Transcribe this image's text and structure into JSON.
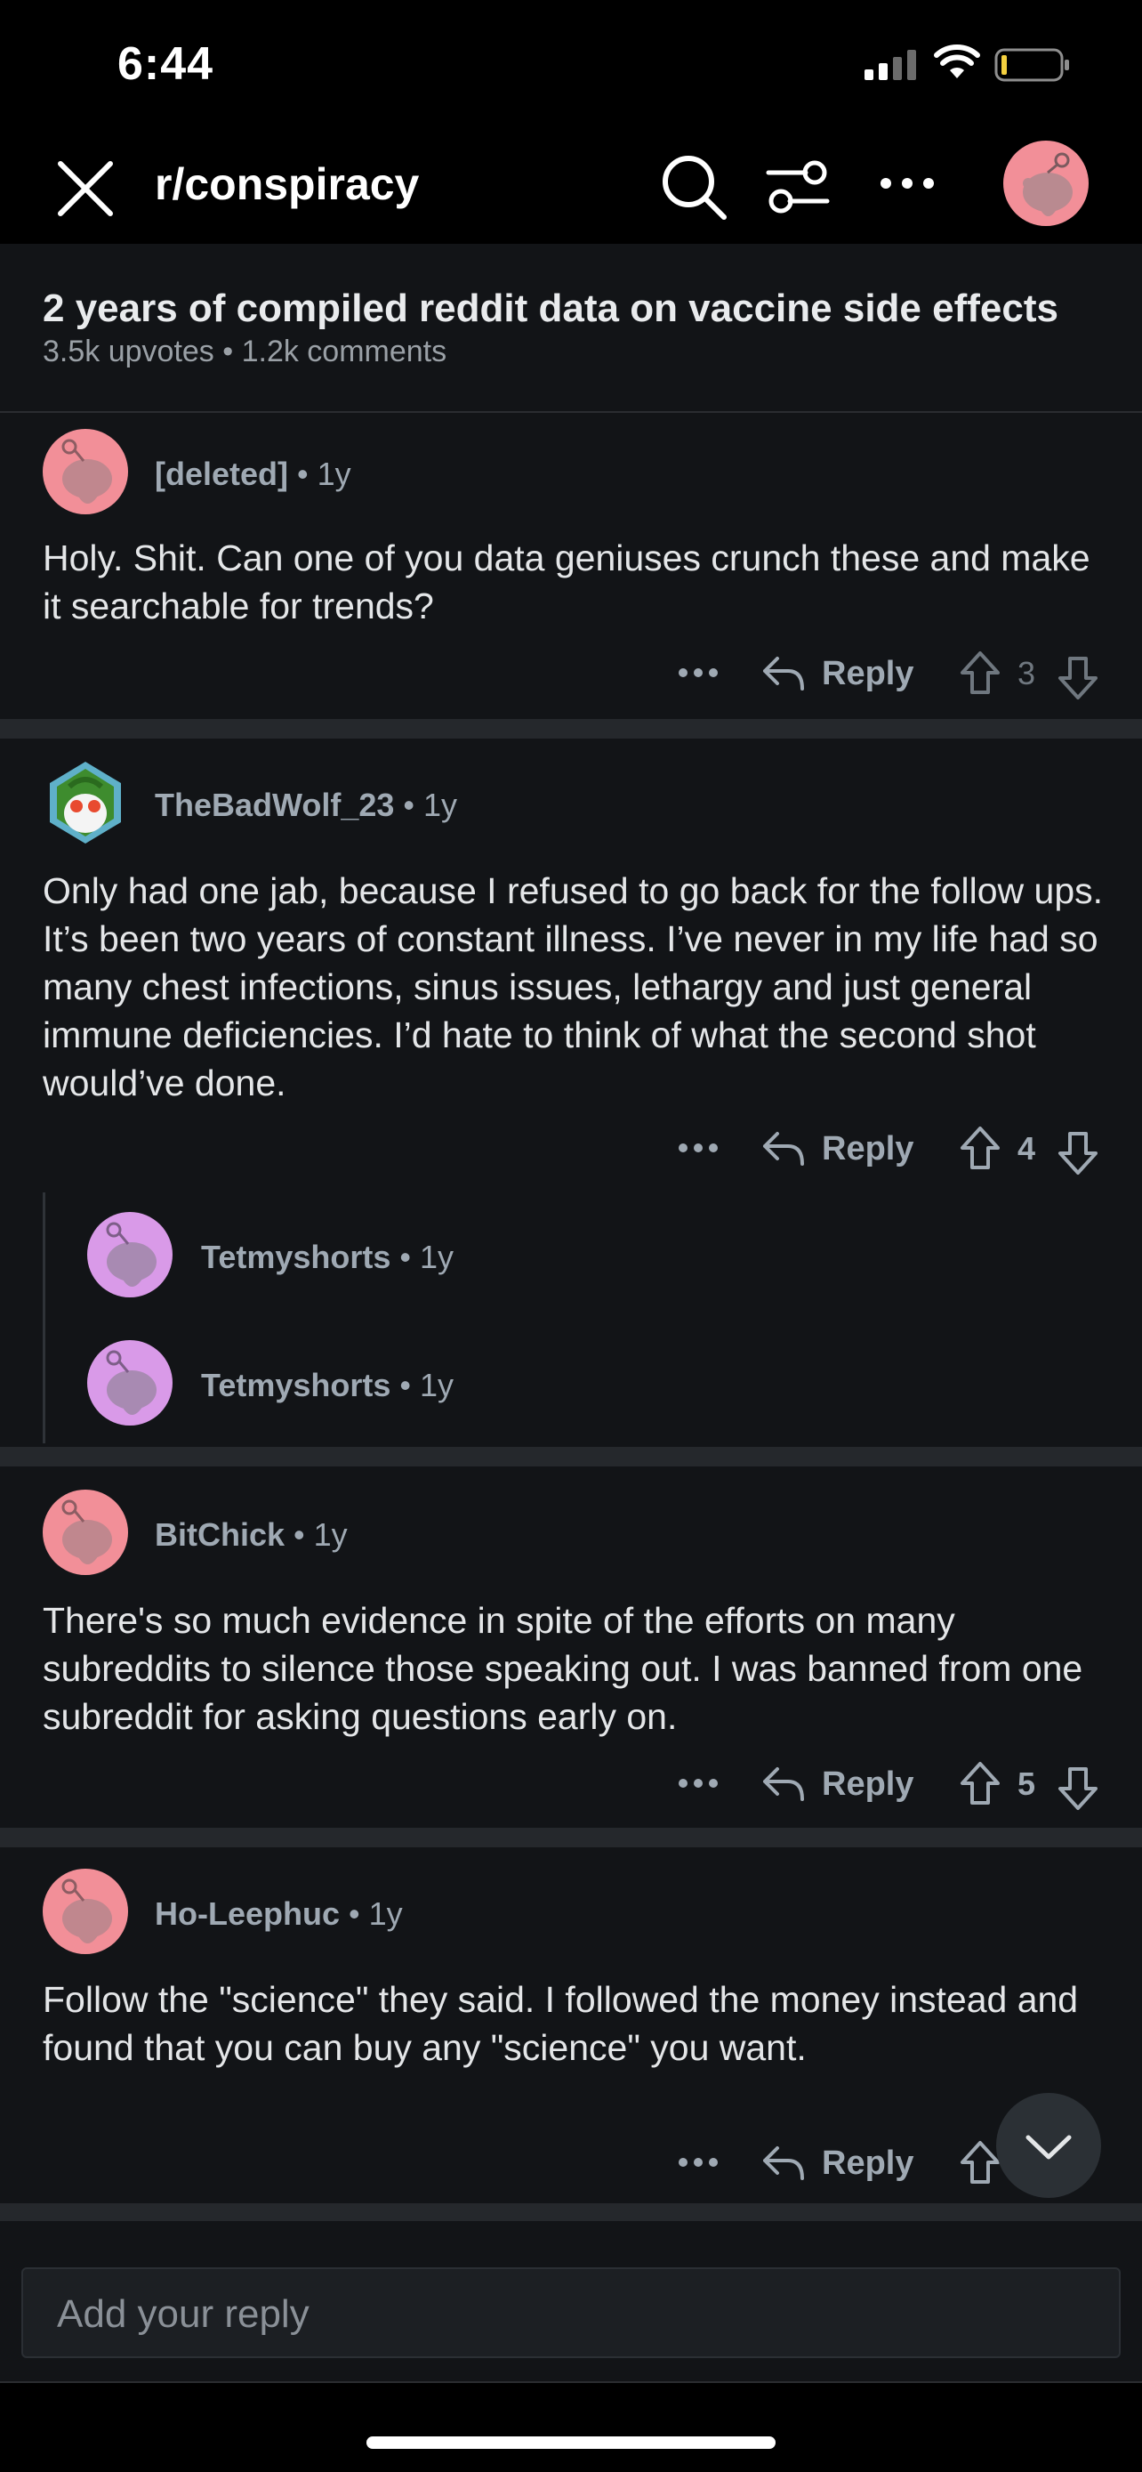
{
  "status": {
    "time": "6:44"
  },
  "nav": {
    "subreddit": "r/conspiracy"
  },
  "post": {
    "title": "2 years of compiled reddit data on vaccine side effects",
    "meta": "3.5k upvotes • 1.2k comments"
  },
  "comments": [
    {
      "user": "[deleted]",
      "age": "1y",
      "body": "Holy. Shit. Can one of you data geniuses crunch these and make it searchable for trends?",
      "reply_label": "Reply",
      "votes": "3"
    },
    {
      "user": "TheBadWolf_23",
      "age": "1y",
      "body": "Only had one jab, because I refused to go back for the follow ups. It’s been two years of constant illness. I’ve never in my life had so many chest infections, sinus issues, lethargy and just general immune deficiencies. I’d hate to think of what the second shot would’ve done.",
      "reply_label": "Reply",
      "votes": "4",
      "children": [
        {
          "user": "Tetmyshorts",
          "age": "1y"
        },
        {
          "user": "Tetmyshorts",
          "age": "1y"
        }
      ]
    },
    {
      "user": "BitChick",
      "age": "1y",
      "body": "There's so much evidence in spite of the efforts on many subreddits to silence those speaking out.  I was banned from one subreddit for asking questions early on.",
      "reply_label": "Reply",
      "votes": "5"
    },
    {
      "user": "Ho-Leephuc",
      "age": "1y",
      "body": "Follow the \"science\" they said. I followed the money instead and found that you can buy any \"science\" you want.",
      "reply_label": "Reply"
    }
  ],
  "reply_box": {
    "placeholder": "Add your reply"
  },
  "colors": {
    "accent_pink": "#f28f98",
    "accent_purple": "#d99ae8",
    "background": "#121417"
  }
}
